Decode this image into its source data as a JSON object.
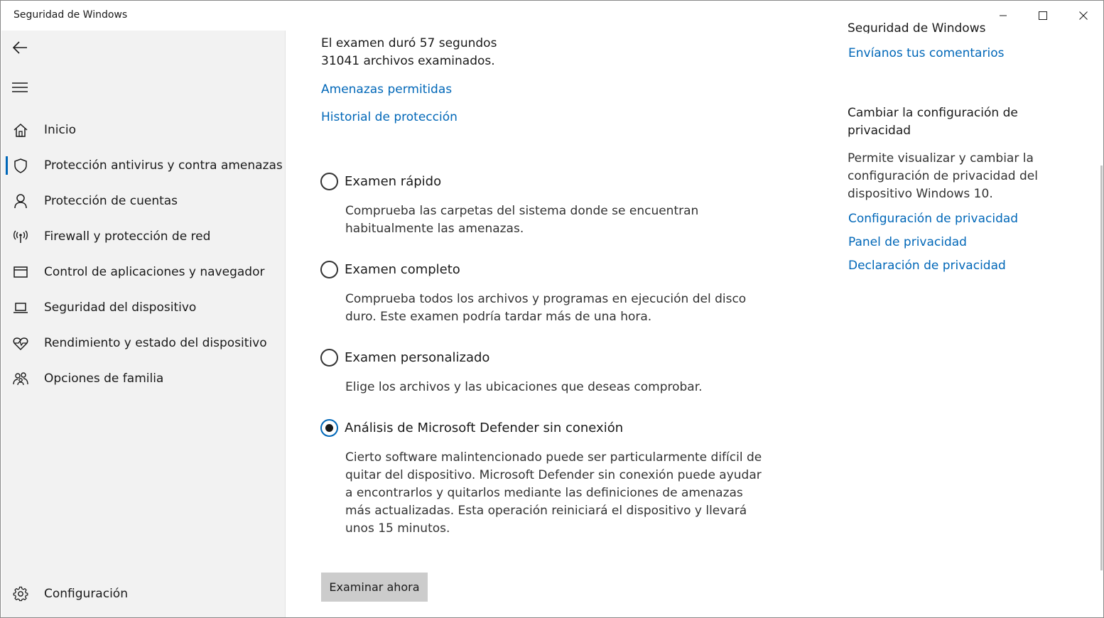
{
  "window": {
    "title": "Seguridad de Windows"
  },
  "sidebar": {
    "back_icon": "back-arrow-icon",
    "menu_icon": "hamburger-icon",
    "items": [
      {
        "label": "Inicio",
        "icon": "home-icon"
      },
      {
        "label": "Protección antivirus y contra amenazas",
        "icon": "shield-icon",
        "active": true
      },
      {
        "label": "Protección de cuentas",
        "icon": "person-icon"
      },
      {
        "label": "Firewall y protección de red",
        "icon": "wireless-icon"
      },
      {
        "label": "Control de aplicaciones y navegador",
        "icon": "browser-window-icon"
      },
      {
        "label": "Seguridad del dispositivo",
        "icon": "laptop-icon"
      },
      {
        "label": "Rendimiento y estado del dispositivo",
        "icon": "heart-pulse-icon"
      },
      {
        "label": "Opciones de familia",
        "icon": "family-icon"
      }
    ],
    "settings_label": "Configuración"
  },
  "main": {
    "scan_duration": "El examen duró 57 segundos",
    "files_scanned": "31041 archivos examinados.",
    "allowed_threats_link": "Amenazas permitidas",
    "protection_history_link": "Historial de protección",
    "options": [
      {
        "label": "Examen rápido",
        "description": "Comprueba las carpetas del sistema donde se encuentran habitualmente las amenazas.",
        "selected": false
      },
      {
        "label": "Examen completo",
        "description": "Comprueba todos los archivos y programas en ejecución del disco duro. Este examen podría tardar más de una hora.",
        "selected": false
      },
      {
        "label": "Examen personalizado",
        "description": "Elige los archivos y las ubicaciones que deseas comprobar.",
        "selected": false
      },
      {
        "label": "Análisis de Microsoft Defender sin conexión",
        "description": "Cierto software malintencionado puede ser particularmente difícil de quitar del dispositivo. Microsoft Defender sin conexión puede ayudar a encontrarlos y quitarlos mediante las definiciones de amenazas más actualizadas. Esta operación reiniciará el dispositivo y llevará unos 15 minutos.",
        "selected": true
      }
    ],
    "scan_button": "Examinar ahora"
  },
  "right": {
    "clipped_heading": "Seguridad de Windows",
    "feedback_link": "Envíanos tus comentarios",
    "privacy_heading": "Cambiar la configuración de privacidad",
    "privacy_text": "Permite visualizar y cambiar la configuración de privacidad del dispositivo Windows 10.",
    "links": [
      "Configuración de privacidad",
      "Panel de privacidad",
      "Declaración de privacidad"
    ]
  },
  "colors": {
    "accent": "#0067b8",
    "sidebar_bg": "#f2f2f2",
    "button_bg": "#cccccc"
  }
}
